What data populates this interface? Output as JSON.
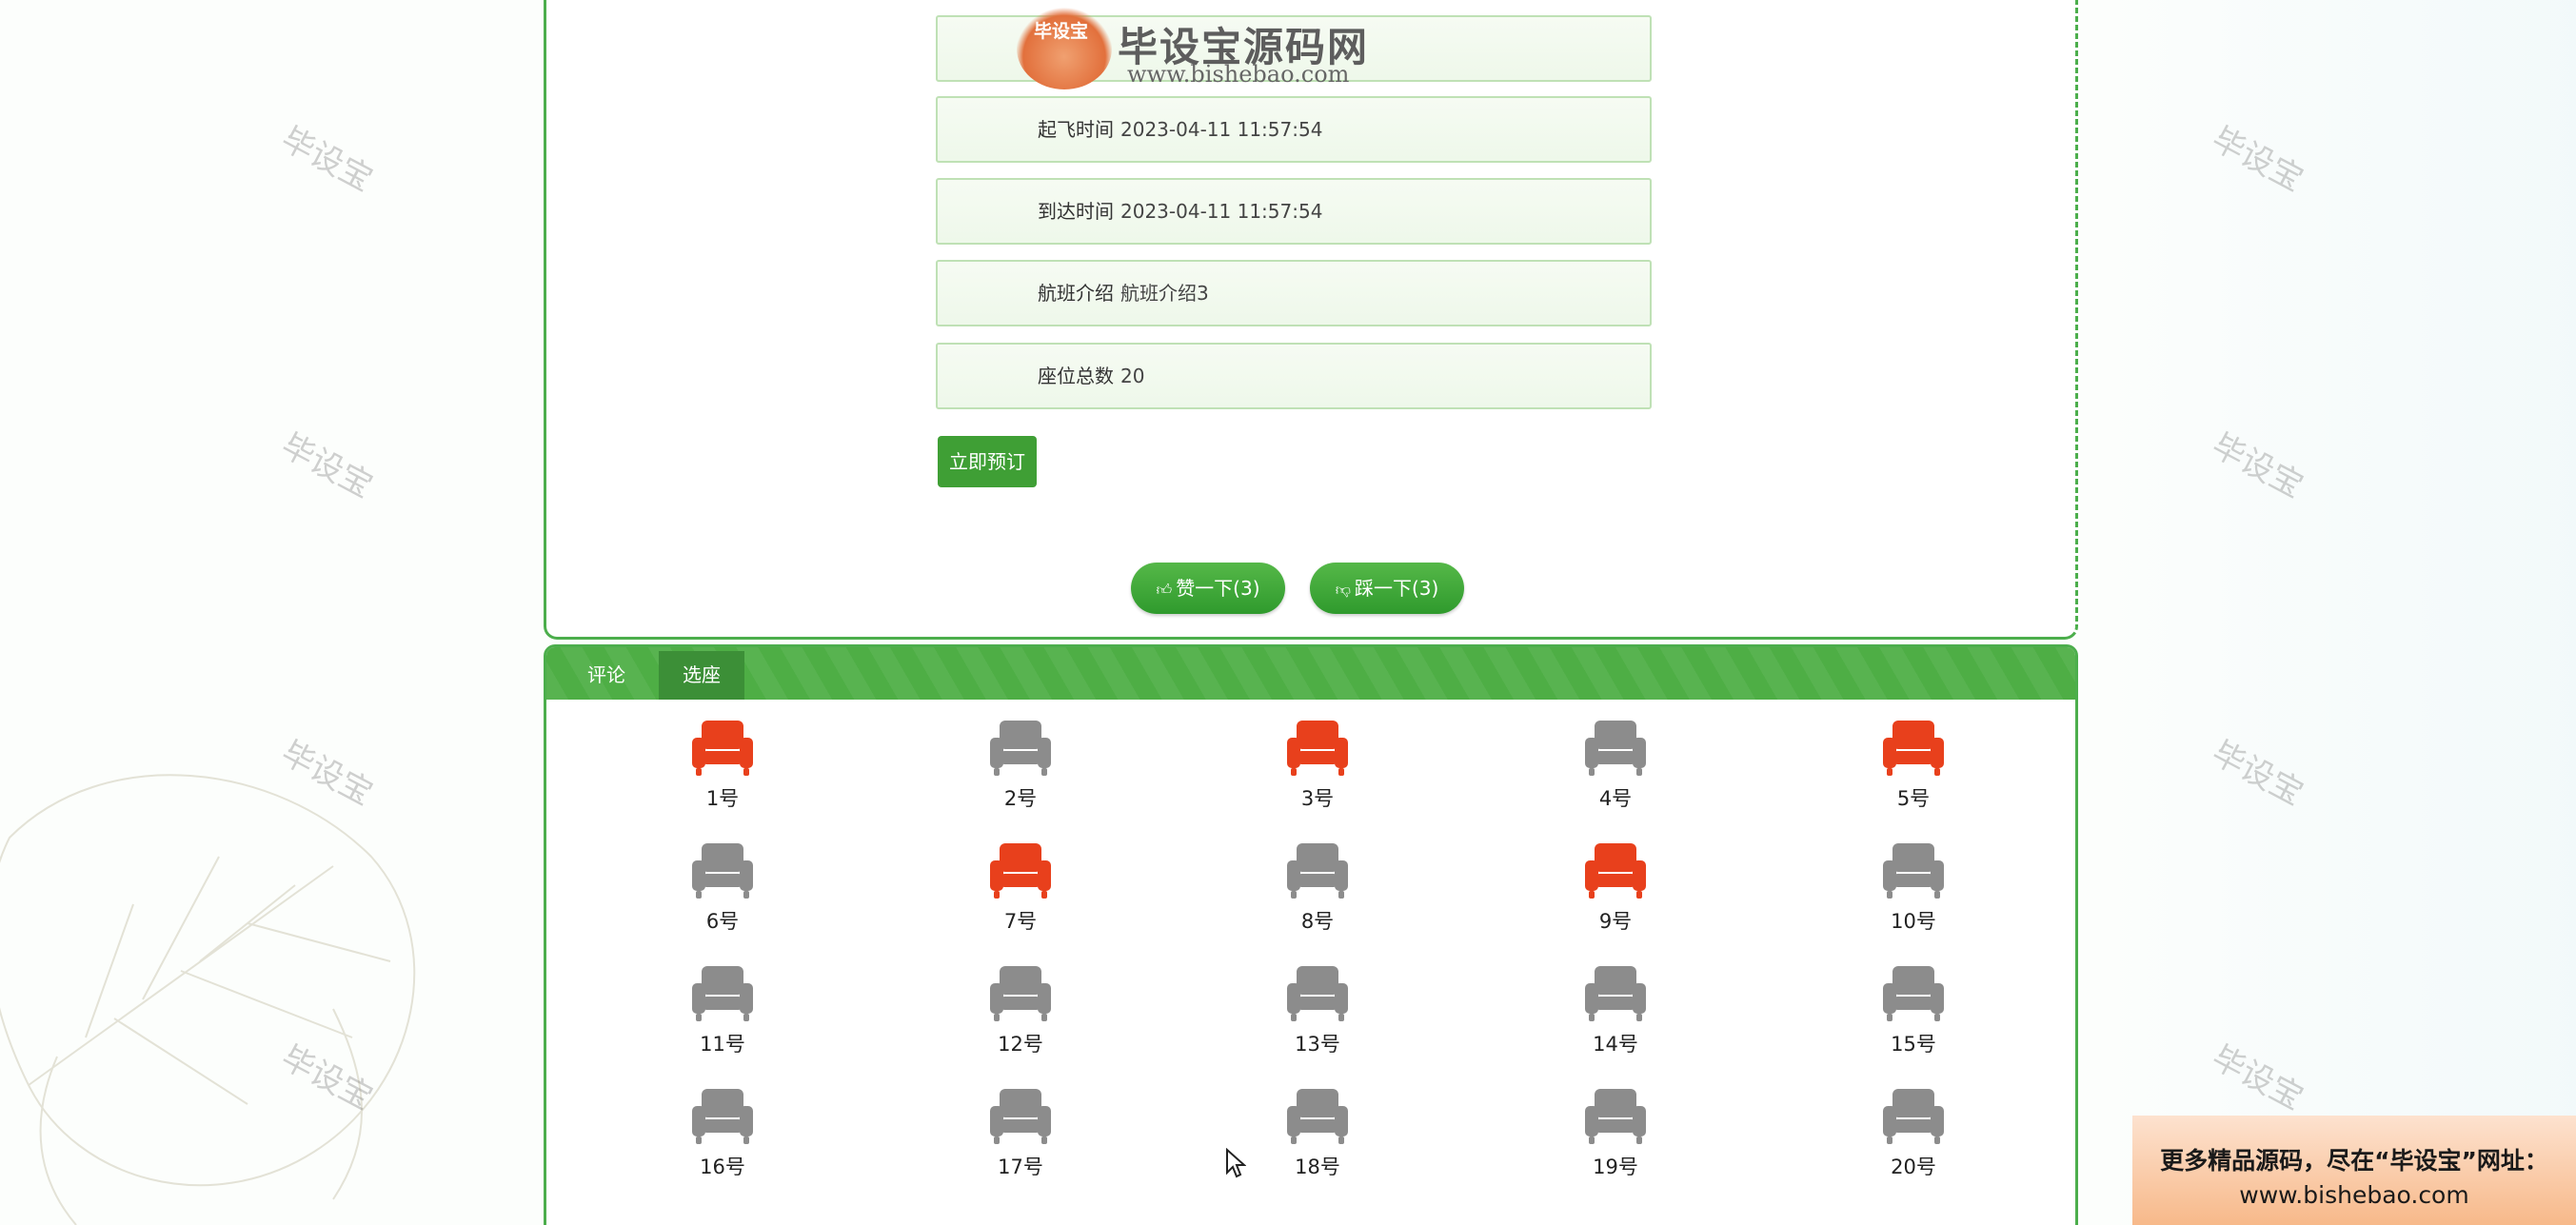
{
  "logo": {
    "badge_text": "毕设宝",
    "title": "毕设宝源码网",
    "url": "www.bishebao.com"
  },
  "watermark_text": "毕设宝",
  "flight_fields": [
    {
      "label": "起飞时间",
      "value": "2023-04-11 11:57:54"
    },
    {
      "label": "到达时间",
      "value": "2023-04-11 11:57:54"
    },
    {
      "label": "航班介绍",
      "value": "航班介绍3"
    },
    {
      "label": "座位总数",
      "value": "20"
    }
  ],
  "book_button": "立即预订",
  "like_button": "赞一下(3)",
  "dislike_button": "踩一下(3)",
  "tabs": [
    {
      "label": "评论",
      "active": false
    },
    {
      "label": "选座",
      "active": true
    }
  ],
  "seats": [
    {
      "label": "1号",
      "booked": true
    },
    {
      "label": "2号",
      "booked": false
    },
    {
      "label": "3号",
      "booked": true
    },
    {
      "label": "4号",
      "booked": false
    },
    {
      "label": "5号",
      "booked": true
    },
    {
      "label": "6号",
      "booked": false
    },
    {
      "label": "7号",
      "booked": true
    },
    {
      "label": "8号",
      "booked": false
    },
    {
      "label": "9号",
      "booked": true
    },
    {
      "label": "10号",
      "booked": false
    },
    {
      "label": "11号",
      "booked": false
    },
    {
      "label": "12号",
      "booked": false
    },
    {
      "label": "13号",
      "booked": false
    },
    {
      "label": "14号",
      "booked": false
    },
    {
      "label": "15号",
      "booked": false
    },
    {
      "label": "16号",
      "booked": false
    },
    {
      "label": "17号",
      "booked": false
    },
    {
      "label": "18号",
      "booked": false
    },
    {
      "label": "19号",
      "booked": false
    },
    {
      "label": "20号",
      "booked": false
    }
  ],
  "colors": {
    "accent_green": "#4eae45",
    "seat_booked": "#e8401c",
    "seat_free": "#8c8c8c"
  },
  "ad": {
    "line1": "更多精品源码，尽在“毕设宝”网址：",
    "line2": "www.bishebao.com"
  }
}
